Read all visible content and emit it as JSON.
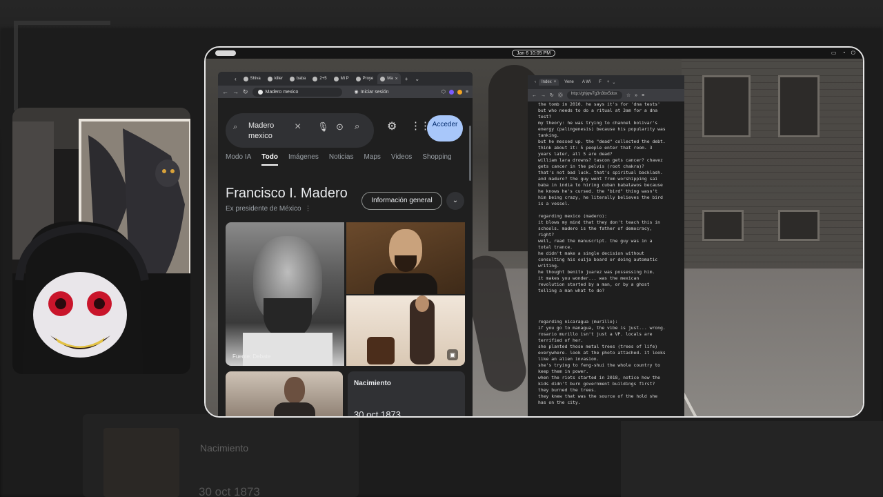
{
  "desktop": {
    "clock": "Jan 6  10:05 PM"
  },
  "left_browser": {
    "tabs": [
      {
        "label": "Shiva"
      },
      {
        "label": "killer"
      },
      {
        "label": "baba"
      },
      {
        "label": "2+5"
      },
      {
        "label": "Mi P"
      },
      {
        "label": "Proye"
      },
      {
        "label": "Ma"
      }
    ],
    "url": "Madero mexico",
    "signin_label": "Iniciar sesión"
  },
  "google": {
    "query": "Madero mexico",
    "acceder_label": "Acceder",
    "nav_tabs": [
      "Modo IA",
      "Todo",
      "Imágenes",
      "Noticias",
      "Maps",
      "Videos",
      "Shopping"
    ],
    "active_tab": "Todo",
    "kp_title": "Francisco I. Madero",
    "kp_subtitle": "Ex presidente de México",
    "info_button": "Información general",
    "image_credit": "Fuente: Debate",
    "birth_label": "Nacimiento",
    "birth_value": "30 oct 1873"
  },
  "right_browser": {
    "tabs": [
      {
        "label": "Index"
      },
      {
        "label": "Vene"
      },
      {
        "label": "A Wi"
      },
      {
        "label": "F"
      }
    ],
    "url": "http://ghjqw7g3n3bx5dox",
    "text": "the tomb in 2010. he says it's for 'dna tests'\nbut who needs to do a ritual at 3am for a dna\ntest?\nmy theory: he was trying to channel bolivar's\nenergy (palingenesis) because his popularity was\ntanking.\nbut he messed up. the \"dead\" collected the debt.\nthink about it: 5 people enter that room. 3\nyears later, all 5 are dead?\nwilliam lara drowns? tascon gets cancer? chavez\ngets cancer in the pelvis (root chakra)?\nthat's not bad luck. that's spiritual backlash.\nand maduro? the guy went from worshipping sai\nbaba in india to hiring cuban babalawos because\nhe knows he's cursed. the \"bird\" thing wasn't\nhim being crazy, he literally believes the bird\nis a vessel.\n\nregarding mexico (madero):\nit blows my mind that they don't teach this in\nschools. madero is the father of democracy,\nright?\nwell, read the manuscript. the guy was in a\ntotal trance.\nhe didn't make a single decision without\nconsulting his ouija board or doing automatic\nwriting.\nhe thought benito juarez was possessing him.\nit makes you wonder... was the mexican\nrevolution started by a man, or by a ghost\ntelling a man what to do?\n\n\n\n\nregarding nicaragua (murillo):\nif you go to managua, the vibe is just... wrong.\nrosario murillo isn't just a VP. locals are\nterrified of her.\nshe planted those metal trees (trees of life)\neverywhere. look at the photo attached. it looks\nlike an alien invasion.\nshe's trying to feng-shui the whole country to\nkeep them in power.\nwhen the riots started in 2018, notice how the\nkids didn't burn government buildings first?\nthey burned the trees.\nthey knew that was the source of the hold she\nhas on the city."
  },
  "background": {
    "ghost_label": "Nacimiento",
    "ghost_date": "30 oct 1873"
  },
  "colors": {
    "acceder_bg": "#a8c7fa",
    "page_bg": "#1f1f1f",
    "text_light": "#e8eaed"
  }
}
